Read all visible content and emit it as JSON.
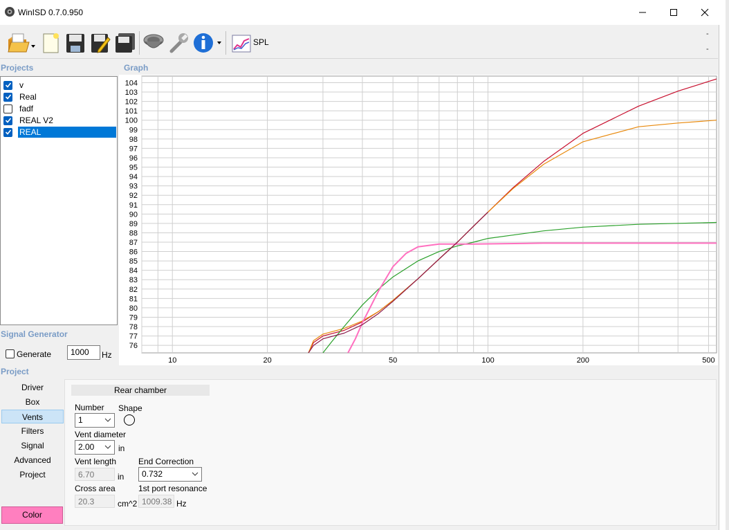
{
  "window": {
    "title": "WinISD 0.7.0.950"
  },
  "toolbar": {
    "spl_label": "SPL",
    "icons": [
      "open-folder-icon",
      "new-document-icon",
      "save-icon",
      "edit-icon",
      "save-all-icon",
      "driver-icon",
      "wrench-icon",
      "info-icon",
      "spl-graph-icon"
    ],
    "dash1": "-",
    "dash2": "-"
  },
  "projects": {
    "title": "Projects",
    "items": [
      {
        "label": "v",
        "checked": true,
        "selected": false
      },
      {
        "label": "Real",
        "checked": true,
        "selected": false
      },
      {
        "label": "fadf",
        "checked": false,
        "selected": false
      },
      {
        "label": "REAL V2",
        "checked": true,
        "selected": false
      },
      {
        "label": "REAL",
        "checked": true,
        "selected": true
      }
    ]
  },
  "graph": {
    "title": "Graph"
  },
  "signal_generator": {
    "title": "Signal Generator",
    "generate_label": "Generate",
    "generate_checked": false,
    "frequency": "1000",
    "unit": "Hz"
  },
  "project_nav": {
    "title": "Project",
    "items": [
      "Driver",
      "Box",
      "Vents",
      "Filters",
      "Signal",
      "Advanced",
      "Project"
    ],
    "active": "Vents",
    "color_button": "Color",
    "color": "#ff7fbf"
  },
  "vents_panel": {
    "header": "Rear chamber",
    "number_label": "Number",
    "number_value": "1",
    "shape_label": "Shape",
    "vent_diameter_label": "Vent diameter",
    "vent_diameter_value": "2.00",
    "vent_diameter_unit": "in",
    "vent_length_label": "Vent length",
    "vent_length_value": "6.70",
    "vent_length_unit": "in",
    "end_correction_label": "End Correction",
    "end_correction_value": "0.732",
    "cross_area_label": "Cross area",
    "cross_area_value": "20.3",
    "cross_area_unit": "cm^2",
    "port_resonance_label": "1st port resonance",
    "port_resonance_value": "1009.38",
    "port_resonance_unit": "Hz"
  },
  "chart_data": {
    "type": "line",
    "title": "",
    "xlabel": "",
    "ylabel": "",
    "x_scale": "log",
    "xlim": [
      8,
      530
    ],
    "ylim": [
      75.2,
      104.7
    ],
    "x_ticks": [
      10,
      20,
      50,
      100,
      200,
      500
    ],
    "y_ticks": [
      76,
      77,
      78,
      79,
      80,
      81,
      82,
      83,
      84,
      85,
      86,
      87,
      88,
      89,
      90,
      91,
      92,
      93,
      94,
      95,
      96,
      97,
      98,
      99,
      100,
      101,
      102,
      103,
      104
    ],
    "grid": true,
    "series": [
      {
        "color": "#c8102e",
        "points": [
          [
            27,
            75.2
          ],
          [
            28,
            76.3
          ],
          [
            30,
            77.0
          ],
          [
            35,
            77.6
          ],
          [
            40,
            78.5
          ],
          [
            45,
            79.6
          ],
          [
            50,
            80.8
          ],
          [
            60,
            83.1
          ],
          [
            70,
            85.2
          ],
          [
            80,
            87.0
          ],
          [
            90,
            88.7
          ],
          [
            100,
            90.2
          ],
          [
            120,
            92.8
          ],
          [
            150,
            95.6
          ],
          [
            200,
            98.6
          ],
          [
            300,
            101.5
          ],
          [
            400,
            103.1
          ],
          [
            530,
            104.4
          ]
        ]
      },
      {
        "color": "#e8880a",
        "points": [
          [
            27,
            75.2
          ],
          [
            28,
            76.5
          ],
          [
            30,
            77.2
          ],
          [
            35,
            77.8
          ],
          [
            40,
            78.6
          ],
          [
            45,
            79.6
          ],
          [
            50,
            80.8
          ],
          [
            60,
            83.1
          ],
          [
            70,
            85.2
          ],
          [
            80,
            87.0
          ],
          [
            90,
            88.7
          ],
          [
            100,
            90.2
          ],
          [
            120,
            92.7
          ],
          [
            150,
            95.3
          ],
          [
            200,
            97.7
          ],
          [
            300,
            99.3
          ],
          [
            400,
            99.7
          ],
          [
            530,
            100.0
          ]
        ]
      },
      {
        "color": "#2aa02a",
        "points": [
          [
            30,
            75.2
          ],
          [
            32,
            76.4
          ],
          [
            35,
            78.0
          ],
          [
            40,
            80.3
          ],
          [
            45,
            82.0
          ],
          [
            50,
            83.3
          ],
          [
            60,
            85.0
          ],
          [
            70,
            86.0
          ],
          [
            80,
            86.6
          ],
          [
            90,
            87.0
          ],
          [
            100,
            87.4
          ],
          [
            150,
            88.2
          ],
          [
            200,
            88.6
          ],
          [
            300,
            88.9
          ],
          [
            530,
            89.1
          ]
        ]
      },
      {
        "color": "#ff6fbf",
        "points": [
          [
            36,
            75.2
          ],
          [
            38,
            76.7
          ],
          [
            40,
            78.4
          ],
          [
            45,
            81.8
          ],
          [
            50,
            84.4
          ],
          [
            55,
            85.8
          ],
          [
            60,
            86.5
          ],
          [
            70,
            86.8
          ],
          [
            80,
            86.8
          ],
          [
            90,
            86.8
          ],
          [
            150,
            86.9
          ],
          [
            530,
            86.9
          ]
        ]
      },
      {
        "color": "#8b1a4a",
        "points": [
          [
            27,
            75.2
          ],
          [
            28,
            76.0
          ],
          [
            30,
            76.7
          ],
          [
            35,
            77.3
          ],
          [
            40,
            78.2
          ],
          [
            45,
            79.4
          ],
          [
            50,
            80.7
          ],
          [
            60,
            83.1
          ],
          [
            70,
            85.2
          ],
          [
            80,
            87.0
          ],
          [
            90,
            88.7
          ],
          [
            100,
            90.2
          ]
        ]
      }
    ]
  }
}
